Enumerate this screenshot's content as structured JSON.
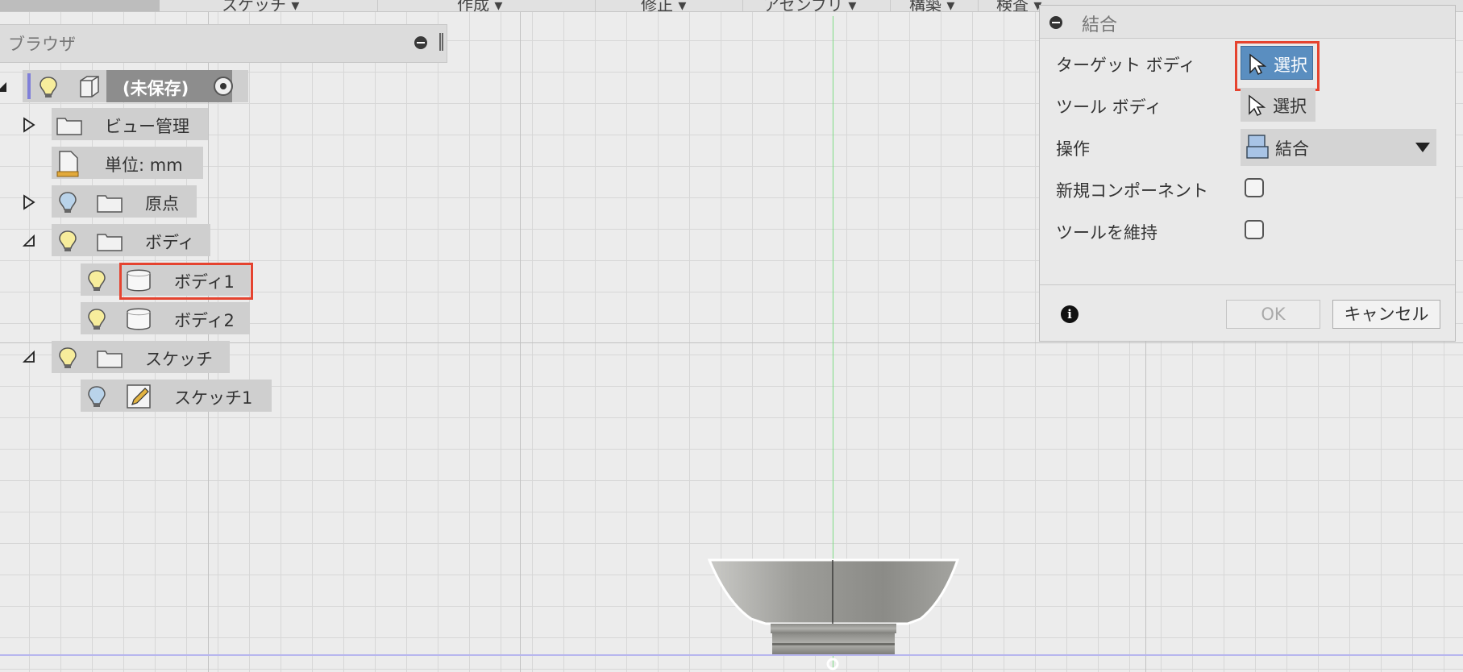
{
  "toolbar": {
    "items": [
      "スケッチ ▾",
      "作成 ▾",
      "修正 ▾",
      "アセンブリ ▾",
      "構築 ▾",
      "検査 ▾"
    ]
  },
  "browser": {
    "title": "ブラウザ",
    "root_label": "(未保存)",
    "items": {
      "view": "ビュー管理",
      "units": "単位: mm",
      "origin": "原点",
      "bodies": "ボディ",
      "body1": "ボディ1",
      "body2": "ボディ2",
      "sketches": "スケッチ",
      "sketch1": "スケッチ1"
    }
  },
  "dialog": {
    "title": "結合",
    "target_label": "ターゲット ボディ",
    "tool_label": "ツール ボディ",
    "operation_label": "操作",
    "new_component_label": "新規コンポーネント",
    "keep_tools_label": "ツールを維持",
    "select_label": "選択",
    "operation_value": "結合",
    "ok_label": "OK",
    "cancel_label": "キャンセル",
    "new_component_checked": false,
    "keep_tools_checked": false
  },
  "colors": {
    "highlight": "#e5432f",
    "active_button": "#5a8ec0",
    "y_axis": "#7fdc85",
    "x_axis": "#b7b6ee"
  }
}
